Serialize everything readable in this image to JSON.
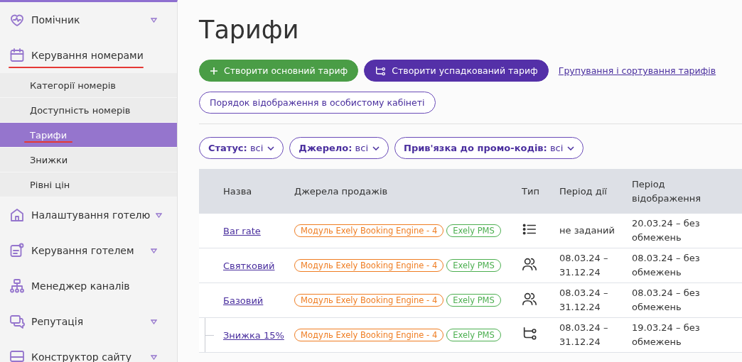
{
  "sidebar": {
    "items": [
      {
        "label": "Помічник",
        "expandable": true,
        "underlined": false
      },
      {
        "label": "Керування номерами",
        "expandable": false,
        "underlined": true,
        "children": [
          {
            "label": "Категорії номерів",
            "selected": false,
            "underlined": false
          },
          {
            "label": "Доступність номерів",
            "selected": false,
            "underlined": false
          },
          {
            "label": "Тарифи",
            "selected": true,
            "underlined": true
          },
          {
            "label": "Знижки",
            "selected": false,
            "underlined": false
          },
          {
            "label": "Рівні цін",
            "selected": false,
            "underlined": false
          }
        ]
      },
      {
        "label": "Налаштування готелю",
        "expandable": true,
        "underlined": false
      },
      {
        "label": "Керування готелем",
        "expandable": true,
        "underlined": false
      },
      {
        "label": "Менеджер каналів",
        "expandable": false,
        "underlined": false
      },
      {
        "label": "Репутація",
        "expandable": true,
        "underlined": false
      },
      {
        "label": "Конструктор сайту",
        "expandable": true,
        "underlined": false
      }
    ]
  },
  "page": {
    "title": "Тарифи",
    "actions": [
      {
        "kind": "primary",
        "label": "Створити основний тариф"
      },
      {
        "kind": "secondary",
        "label": "Створити успадкований тариф"
      },
      {
        "kind": "link",
        "label": "Групування і сортування тарифів"
      },
      {
        "kind": "outline",
        "label": "Порядок відображення в особистому кабінеті"
      }
    ],
    "filters": [
      {
        "name": "Статус:",
        "value": "всі"
      },
      {
        "name": "Джерело:",
        "value": "всі"
      },
      {
        "name": "Прив'язка до промо-кодів:",
        "value": "всі"
      }
    ],
    "table": {
      "columns": [
        "Назва",
        "Джерела продажів",
        "Тип",
        "Період дії",
        "Період відображення"
      ],
      "rows": [
        {
          "name": "Bar rate",
          "sources": [
            {
              "label": "Модуль Exely Booking Engine - 4",
              "color": "#ef7d22"
            },
            {
              "label": "Exely PMS",
              "color": "#4caf50"
            }
          ],
          "kind": "list",
          "period": "не заданий",
          "display": "20.03.24 – без обмежень"
        },
        {
          "name": "Святковий",
          "sources": [
            {
              "label": "Модуль Exely Booking Engine - 4",
              "color": "#ef7d22"
            },
            {
              "label": "Exely PMS",
              "color": "#4caf50"
            }
          ],
          "kind": "people",
          "period": "08.03.24 – 31.12.24",
          "display": "08.03.24 – без обмежень"
        },
        {
          "name": "Базовий",
          "sources": [
            {
              "label": "Модуль Exely Booking Engine - 4",
              "color": "#ef7d22"
            },
            {
              "label": "Exely PMS",
              "color": "#4caf50"
            }
          ],
          "kind": "people",
          "period": "08.03.24 – 31.12.24",
          "display": "08.03.24 – без обмежень",
          "children": [
            {
              "name": "Знижка 15%",
              "sources": [
                {
                  "label": "Модуль Exely Booking Engine - 4",
                  "color": "#ef7d22"
                },
                {
                  "label": "Exely PMS",
                  "color": "#4caf50"
                }
              ],
              "kind": "branch",
              "period": "08.03.24 – 31.12.24",
              "display": "19.03.24 – без обмежень"
            }
          ]
        }
      ]
    }
  }
}
